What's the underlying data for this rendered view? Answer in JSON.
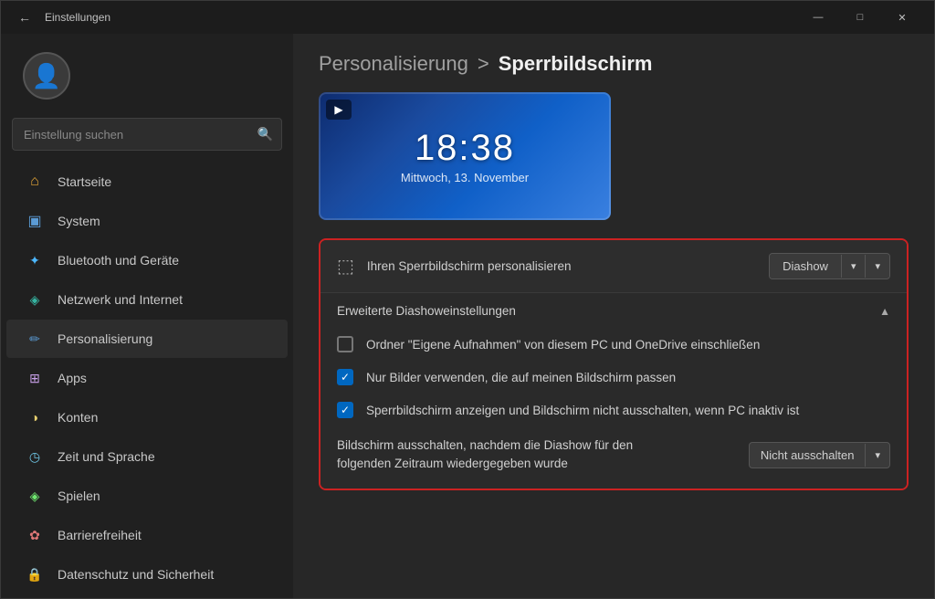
{
  "titlebar": {
    "title": "Einstellungen",
    "back_label": "←",
    "minimize_label": "—",
    "maximize_label": "□",
    "close_label": "✕"
  },
  "sidebar": {
    "search_placeholder": "Einstellung suchen",
    "nav_items": [
      {
        "id": "home",
        "label": "Startseite",
        "icon": "🏠",
        "icon_class": "home"
      },
      {
        "id": "system",
        "label": "System",
        "icon": "🖥",
        "icon_class": "system"
      },
      {
        "id": "bluetooth",
        "label": "Bluetooth und Geräte",
        "icon": "✦",
        "icon_class": "bluetooth"
      },
      {
        "id": "network",
        "label": "Netzwerk und Internet",
        "icon": "🌐",
        "icon_class": "network"
      },
      {
        "id": "personalization",
        "label": "Personalisierung",
        "icon": "✏",
        "icon_class": "personalization",
        "active": true
      },
      {
        "id": "apps",
        "label": "Apps",
        "icon": "⊞",
        "icon_class": "apps"
      },
      {
        "id": "accounts",
        "label": "Konten",
        "icon": "👤",
        "icon_class": "accounts"
      },
      {
        "id": "time",
        "label": "Zeit und Sprache",
        "icon": "🕐",
        "icon_class": "time"
      },
      {
        "id": "gaming",
        "label": "Spielen",
        "icon": "🎮",
        "icon_class": "gaming"
      },
      {
        "id": "accessibility",
        "label": "Barrierefreiheit",
        "icon": "♿",
        "icon_class": "accessibility"
      },
      {
        "id": "privacy",
        "label": "Datenschutz und Sicherheit",
        "icon": "🔒",
        "icon_class": "privacy"
      }
    ]
  },
  "page": {
    "breadcrumb_parent": "Personalisierung",
    "breadcrumb_sep": ">",
    "breadcrumb_current": "Sperrbildschirm",
    "lockscreen_time": "18:38",
    "lockscreen_date": "Mittwoch, 13. November"
  },
  "settings": {
    "personalize_label": "Ihren Sperrbildschirm personalisieren",
    "dropdown_value": "Diashow",
    "slideshow_section_title": "Erweiterte Diashoweinstellungen",
    "checkbox1_label": "Ordner \"Eigene Aufnahmen\" von diesem PC und OneDrive einschließen",
    "checkbox1_checked": false,
    "checkbox2_label": "Nur Bilder verwenden, die auf meinen Bildschirm passen",
    "checkbox2_checked": true,
    "checkbox3_label": "Sperrbildschirm anzeigen und Bildschirm nicht ausschalten, wenn PC inaktiv ist",
    "checkbox3_checked": true,
    "turnoff_label_line1": "Bildschirm ausschalten, nachdem die Diashow für den",
    "turnoff_label_line2": "folgenden Zeitraum wiedergegeben wurde",
    "turnoff_value": "Nicht ausschalten"
  }
}
